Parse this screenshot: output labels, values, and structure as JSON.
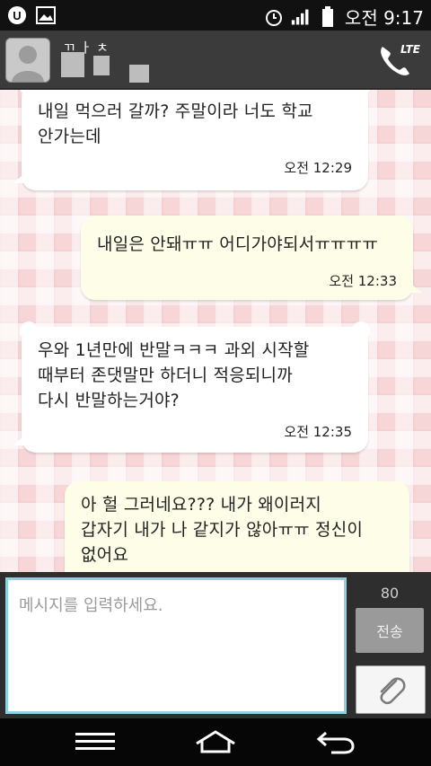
{
  "status_bar": {
    "time": "오전 9:17",
    "icons": [
      "u-plus-icon",
      "image-icon",
      "alarm-icon",
      "signal-icon",
      "battery-icon"
    ]
  },
  "header": {
    "contact_name_partial": "ㄲ ㅏ ㅊ",
    "call_badge": "LTE"
  },
  "messages": [
    {
      "direction": "in",
      "text": "내일 먹으러 갈까? 주말이라 너도 학교\n안가는데",
      "time": "오전 12:29"
    },
    {
      "direction": "out",
      "text": "내일은 안돼ㅠㅠ 어디가야되서ㅠㅠㅠㅠ",
      "time": "오전 12:33"
    },
    {
      "direction": "in",
      "text": "우와 1년만에 반말ㅋㅋㅋ 과외 시작할\n때부터 존댓말만 하더니 적응되니까\n다시 반말하는거야?",
      "time": "오전 12:35"
    },
    {
      "direction": "out",
      "text": "아 헐 그러네요??? 내가 왜이러지\n갑자기 내가 나 같지가 않아ㅠㅠ 정신이\n없어요",
      "time": ""
    }
  ],
  "input": {
    "placeholder": "메시지를 입력하세요.",
    "value": "",
    "char_count": "80",
    "send_label": "전송"
  },
  "colors": {
    "incoming_bubble": "#ffffff",
    "outgoing_bubble": "#fefde8",
    "input_border": "#8fd3e0",
    "background_plaid": "#f6d6d7"
  }
}
